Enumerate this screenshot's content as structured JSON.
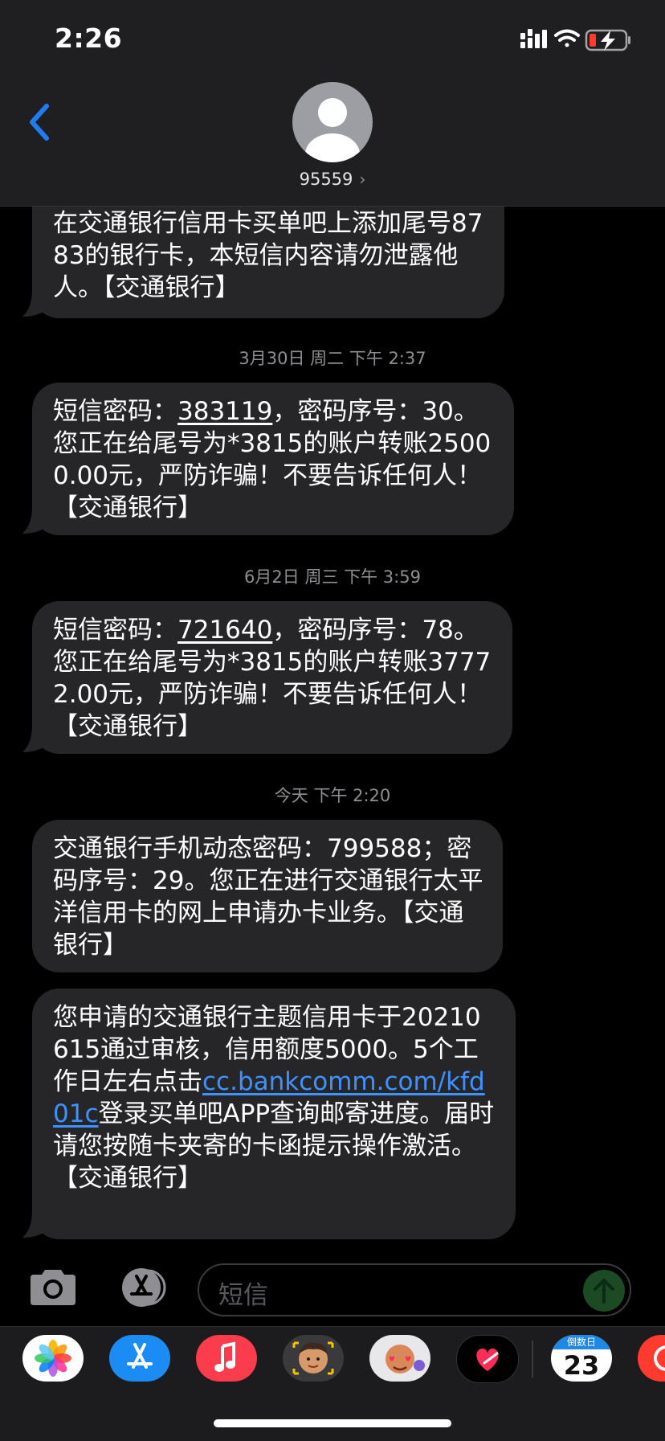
{
  "status_bar": {
    "time": "2:26"
  },
  "header": {
    "contact": "95559"
  },
  "messages": {
    "m1": "在交通银行信用卡买单吧上添加尾号8783的银行卡，本短信内容请勿泄露他人。【交通银行】",
    "ts2": "3月30日 周二 下午 2:37",
    "m2_pre": "短信密码：",
    "m2_code": "383119",
    "m2_post": "，密码序号：30。您正在给尾号为*3815的账户转账25000.00元，严防诈骗！不要告诉任何人！【交通银行】",
    "ts3": "6月2日 周三 下午 3:59",
    "m3_pre": "短信密码：",
    "m3_code": "721640",
    "m3_post": "，密码序号：78。您正在给尾号为*3815的账户转账37772.00元，严防诈骗！不要告诉任何人！【交通银行】",
    "ts4": "今天 下午 2:20",
    "m4": "交通银行手机动态密码：799588；密码序号：29。您正在进行交通银行太平洋信用卡的网上申请办卡业务。【交通银行】",
    "m5_pre": "您申请的交通银行主题信用卡于20210615通过审核，信用额度5000。5个工作日左右点击",
    "m5_link": "cc.bankcomm.com/kfd01c",
    "m5_post": "登录买单吧APP查询邮寄进度。届时请您按随卡夹寄的卡函提示操作激活。【交通银行】"
  },
  "composer": {
    "placeholder": "短信"
  },
  "app_drawer": {
    "apps": [
      "photos-icon",
      "app-store-icon",
      "music-icon",
      "memoji-icon",
      "animoji-icon",
      "digital-touch-icon",
      "countdown-icon",
      "partial-app-icon"
    ],
    "countdown_label": "倒数日",
    "countdown_value": "23"
  },
  "colors": {
    "bubble": "#262628",
    "link": "#3e92ff",
    "accent_back": "#1f7cf5",
    "timestamp": "#8e8e93"
  }
}
